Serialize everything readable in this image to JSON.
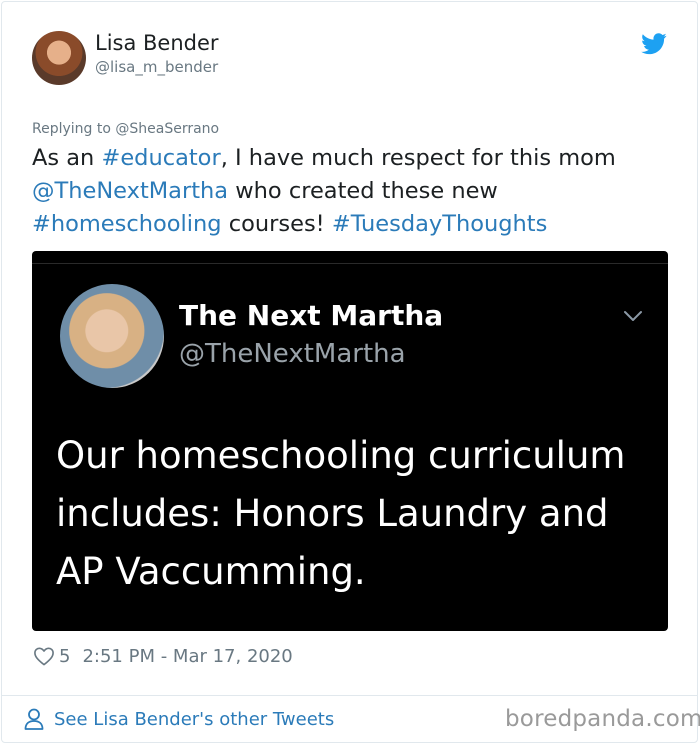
{
  "author": {
    "name": "Lisa Bender",
    "handle": "@lisa_m_bender"
  },
  "reply_to": "Replying to @SheaSerrano",
  "tweet": {
    "segments": [
      {
        "text": "As an ",
        "link": false
      },
      {
        "text": "#educator",
        "link": true
      },
      {
        "text": ", I have much respect for this mom ",
        "link": false
      },
      {
        "text": "@TheNextMartha",
        "link": true
      },
      {
        "text": " who created these new ",
        "link": false
      },
      {
        "text": "#homeschooling",
        "link": true
      },
      {
        "text": " courses! ",
        "link": false
      },
      {
        "text": "#TuesdayThoughts",
        "link": true
      }
    ]
  },
  "embedded_tweet": {
    "name": "The Next Martha",
    "handle": "@TheNextMartha",
    "text": "Our homeschooling curriculum includes: Honors Laundry and AP Vaccumming."
  },
  "meta": {
    "likes": "5",
    "timestamp": "2:51 PM - Mar 17, 2020"
  },
  "footer": {
    "link_label": "See Lisa Bender's other Tweets",
    "watermark": "boredpanda.com"
  },
  "colors": {
    "link": "#2b7bb9",
    "twitter_blue": "#1da1f2",
    "muted": "#697882"
  },
  "icons": [
    "twitter-bird-icon",
    "chevron-down-icon",
    "heart-icon",
    "person-icon"
  ]
}
